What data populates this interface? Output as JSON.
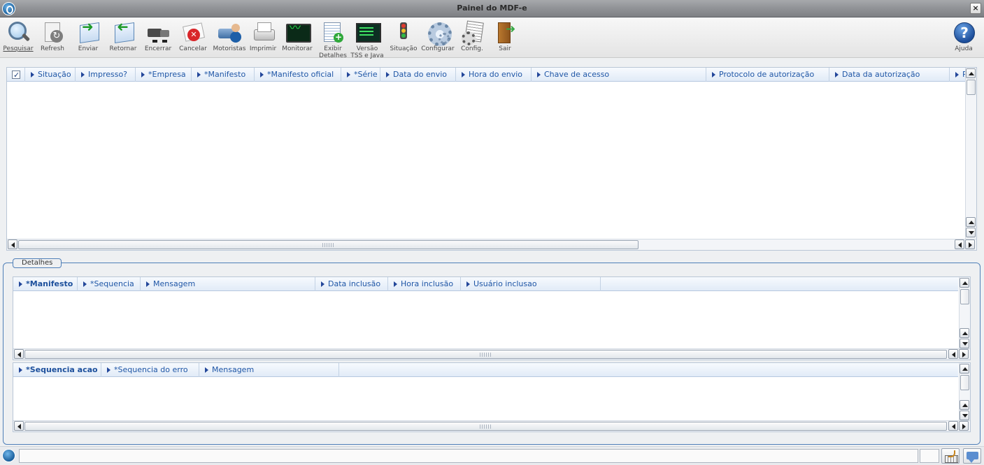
{
  "window": {
    "title": "Painel do MDF-e",
    "close_label": "×"
  },
  "toolbar": {
    "items": [
      {
        "label": "Pesquisar",
        "icon": "search-icon"
      },
      {
        "label": "Refresh",
        "icon": "refresh-icon"
      },
      {
        "label": "Enviar",
        "icon": "send-icon"
      },
      {
        "label": "Retornar",
        "icon": "return-icon"
      },
      {
        "label": "Encerrar",
        "icon": "truck-icon"
      },
      {
        "label": "Cancelar",
        "icon": "cancel-icon"
      },
      {
        "label": "Motoristas",
        "icon": "drivers-icon"
      },
      {
        "label": "Imprimir",
        "icon": "printer-icon"
      },
      {
        "label": "Monitorar",
        "icon": "monitor-icon"
      },
      {
        "label": "Exibir Detalhes",
        "icon": "details-icon"
      },
      {
        "label": "Versão TSS e Java",
        "icon": "version-icon"
      },
      {
        "label": "Situação",
        "icon": "traffic-light-icon"
      },
      {
        "label": "Configurar",
        "icon": "gear-icon"
      },
      {
        "label": "Config.",
        "icon": "config-icon"
      },
      {
        "label": "Sair",
        "icon": "exit-door-icon"
      }
    ],
    "help_label": "Ajuda"
  },
  "main_grid": {
    "columns": [
      "Situação",
      "Impresso?",
      "*Empresa",
      "*Manifesto",
      "*Manifesto oficial",
      "*Série",
      "Data do envio",
      "Hora do envio",
      "Chave de acesso",
      "Protocolo de autorização",
      "Data da autorização",
      "P"
    ],
    "rows": []
  },
  "details": {
    "legend": "Detalhes",
    "grid1": {
      "columns": [
        "*Manifesto",
        "*Sequencia",
        "Mensagem",
        "Data inclusão",
        "Hora inclusão",
        "Usuário inclusao"
      ],
      "rows": []
    },
    "grid2": {
      "columns": [
        "*Sequencia acao",
        "*Sequencia do erro",
        "Mensagem"
      ],
      "rows": []
    }
  },
  "statusbar": {
    "message": ""
  }
}
